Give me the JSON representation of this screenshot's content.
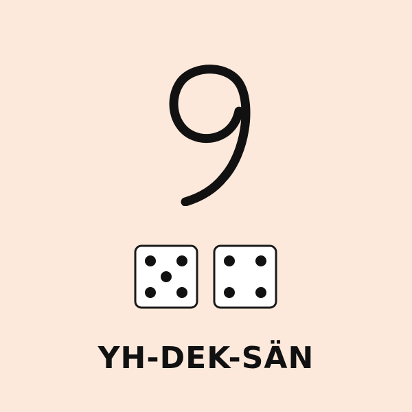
{
  "number": {
    "value": 9,
    "color": "#111111"
  },
  "dice": [
    {
      "pips": 5
    },
    {
      "pips": 4
    }
  ],
  "caption": "YH-DEK-SÄN",
  "colors": {
    "background": "#fce9db",
    "die_face": "#ffffff",
    "die_border": "#1a1a1a",
    "pip": "#111111"
  }
}
